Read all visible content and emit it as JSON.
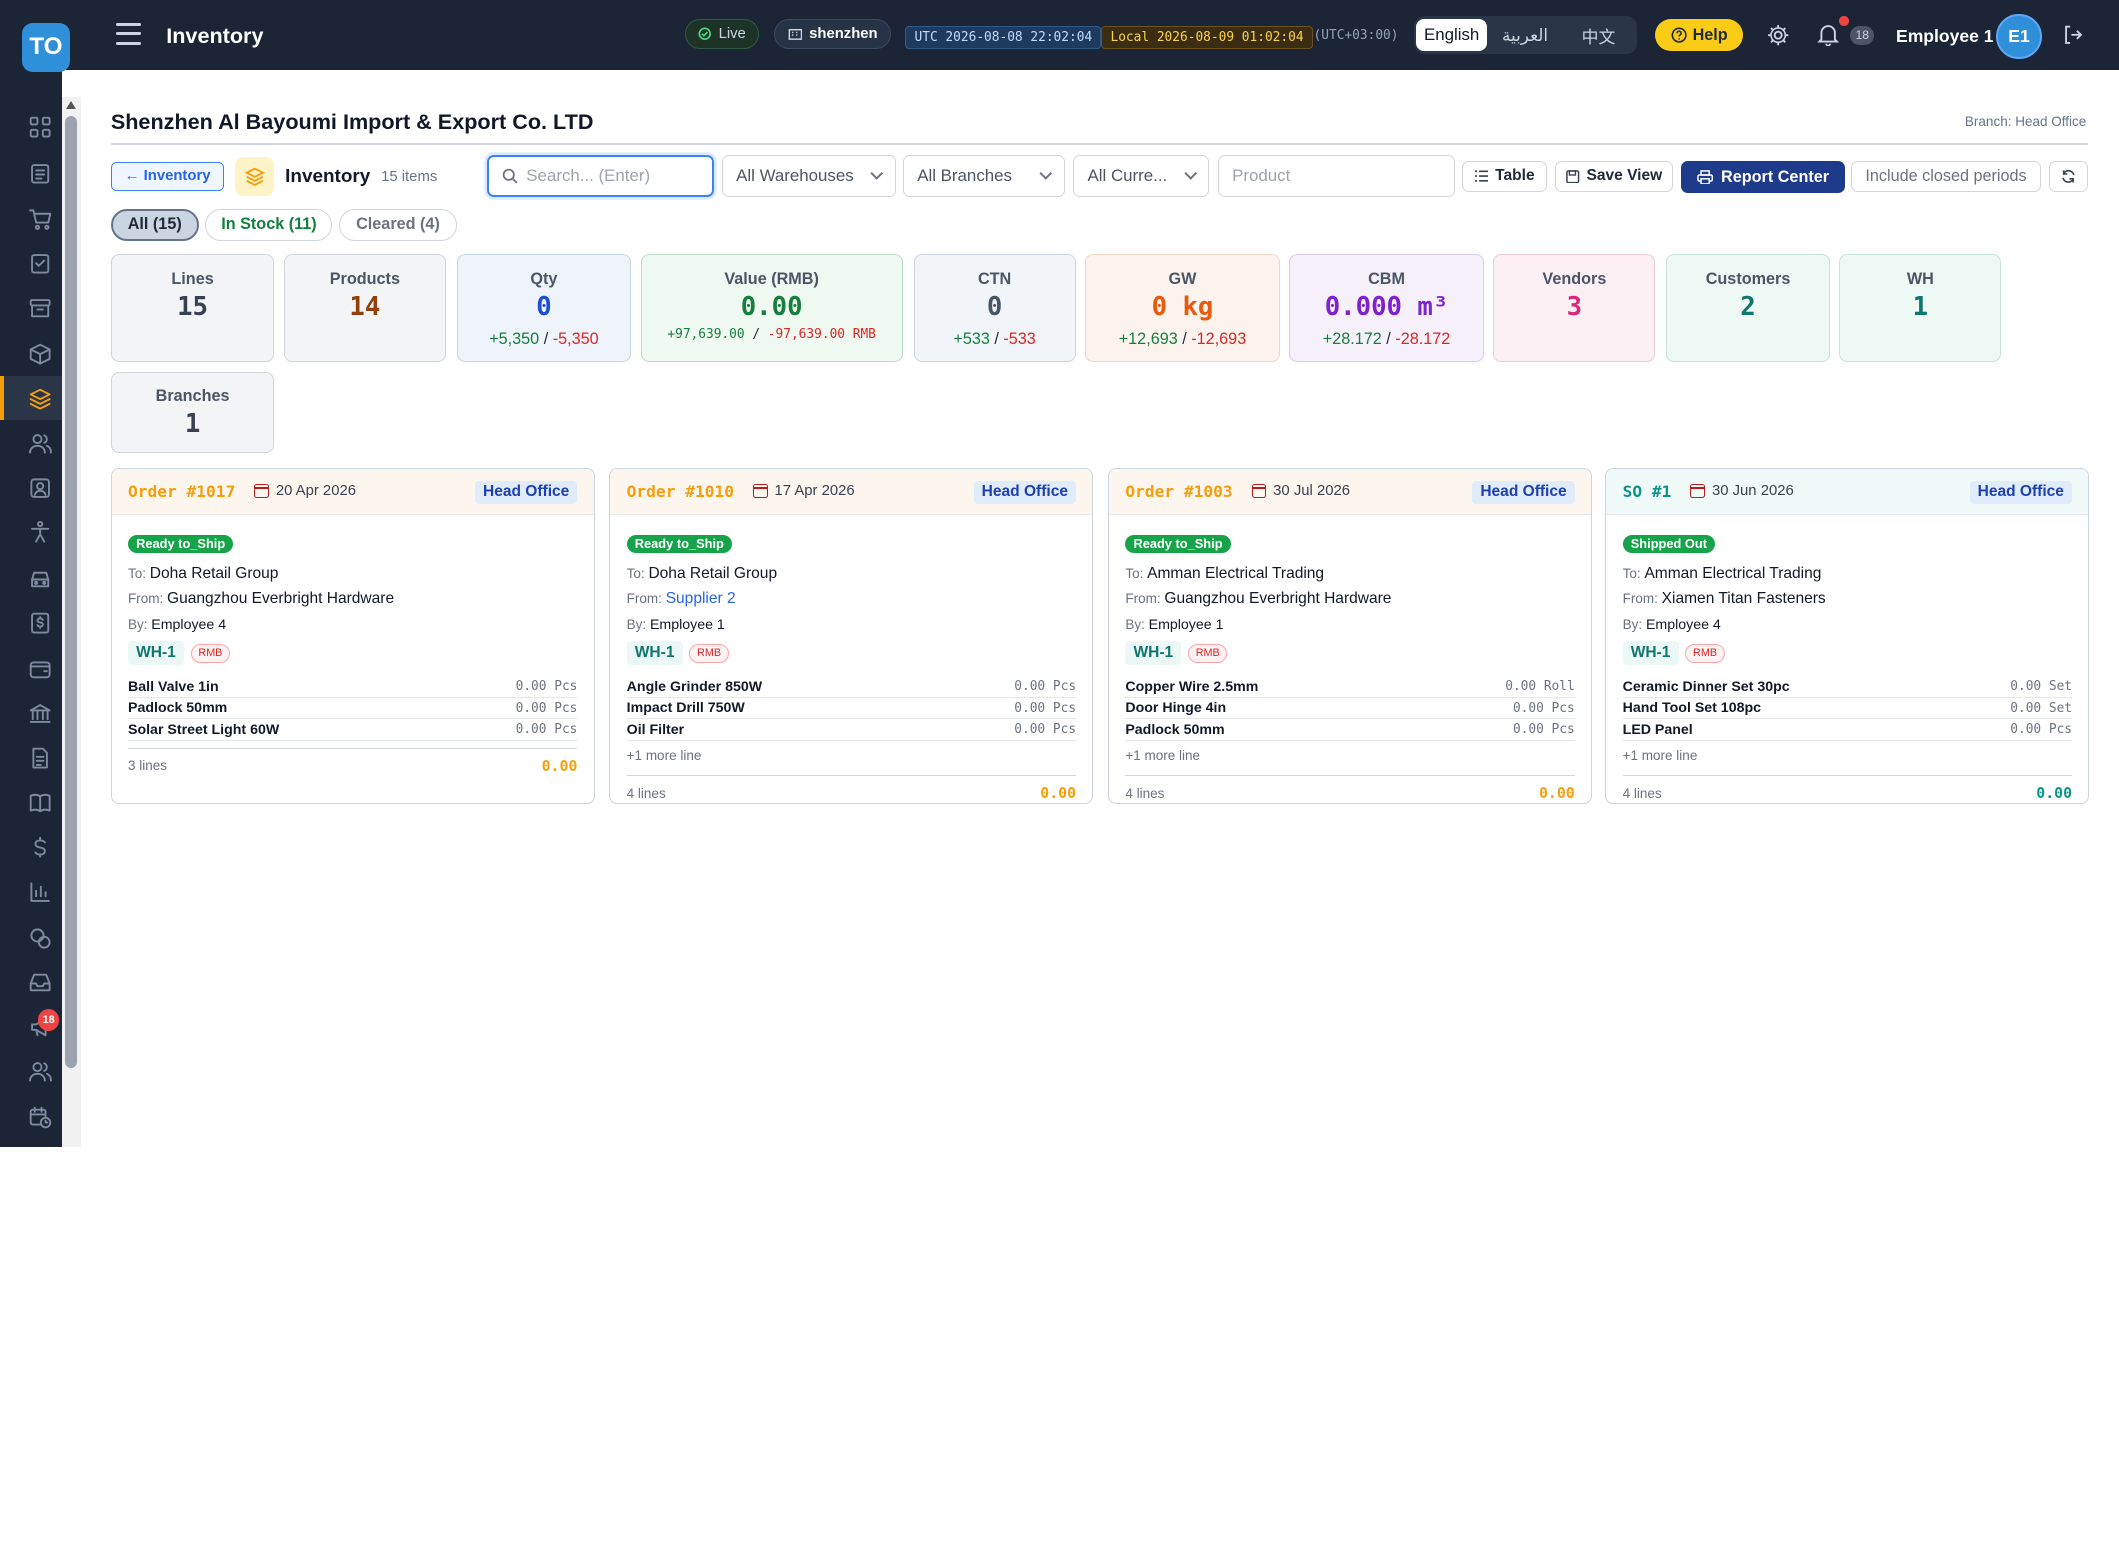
{
  "app": {
    "logo": "TO",
    "title": "Inventory"
  },
  "topbar": {
    "live": "Live",
    "branch": "shenzhen",
    "utc": "UTC 2026-08-08 22:02:04",
    "local": "Local 2026-08-09 01:02:04",
    "offset": "(UTC+03:00)",
    "languages": [
      "English",
      "العربية",
      "中文"
    ],
    "active_language": "English",
    "help": "Help",
    "notifications": "18",
    "user": "Employee 1",
    "avatar": "E1"
  },
  "sidebar": {
    "badge": "18",
    "icons": [
      "dashboard-icon",
      "clipboard-icon",
      "cart-icon",
      "checklist-icon",
      "archive-icon",
      "box-icon",
      "layers-icon",
      "users-icon",
      "contacts-icon",
      "person-icon",
      "car-icon",
      "dollar-doc-icon",
      "wallet-icon",
      "bank-icon",
      "document-icon",
      "book-icon",
      "dollar-icon",
      "bar-chart-icon",
      "coins-icon",
      "inbox-icon",
      "megaphone-icon",
      "team-icon",
      "calendar-clock-icon"
    ]
  },
  "page": {
    "company": "Shenzhen Al Bayoumi Import & Export Co. LTD",
    "branch_label": "Branch: Head Office",
    "back_label": "← Inventory",
    "title": "Inventory",
    "count": "15 items"
  },
  "toolbar": {
    "search_placeholder": "Search... (Enter)",
    "warehouses": "All Warehouses",
    "branches": "All Branches",
    "currencies": "All Curre...",
    "product_placeholder": "Product",
    "table": "Table",
    "save_view": "Save View",
    "report_center": "Report Center",
    "include_closed": "Include closed periods"
  },
  "filters": {
    "all": "All (15)",
    "in_stock": "In Stock (11)",
    "cleared": "Cleared (4)"
  },
  "stats": {
    "lines": {
      "label": "Lines",
      "value": "15"
    },
    "products": {
      "label": "Products",
      "value": "14"
    },
    "qty": {
      "label": "Qty",
      "value": "0",
      "plus": "+5,350",
      "minus": "-5,350"
    },
    "value": {
      "label": "Value (RMB)",
      "value": "0.00",
      "plus": "+97,639.00",
      "minus": "-97,639.00 RMB"
    },
    "ctn": {
      "label": "CTN",
      "value": "0",
      "plus": "+533",
      "minus": "-533"
    },
    "gw": {
      "label": "GW",
      "value": "0 kg",
      "plus": "+12,693",
      "minus": "-12,693"
    },
    "cbm": {
      "label": "CBM",
      "value": "0.000 m³",
      "plus": "+28.172",
      "minus": "-28.172"
    },
    "vendors": {
      "label": "Vendors",
      "value": "3"
    },
    "customers": {
      "label": "Customers",
      "value": "2"
    },
    "wh": {
      "label": "WH",
      "value": "1"
    },
    "branches": {
      "label": "Branches",
      "value": "1"
    }
  },
  "cards": [
    {
      "order": "Order #1017",
      "date": "20 Apr 2026",
      "branch": "Head Office",
      "status": "Ready to_Ship",
      "to_label": "To:",
      "to": "Doha Retail Group",
      "from_label": "From:",
      "from": "Guangzhou Everbright Hardware",
      "by_label": "By:",
      "by": "Employee 4",
      "wh": "WH-1",
      "cur": "RMB",
      "items": [
        {
          "name": "Ball Valve 1in",
          "qty": "0.00 Pcs"
        },
        {
          "name": "Padlock 50mm",
          "qty": "0.00 Pcs"
        },
        {
          "name": "Solar Street Light 60W",
          "qty": "0.00 Pcs"
        }
      ],
      "more": "",
      "lines": "3 lines",
      "total": "0.00"
    },
    {
      "order": "Order #1010",
      "date": "17 Apr 2026",
      "branch": "Head Office",
      "status": "Ready to_Ship",
      "to_label": "To:",
      "to": "Doha Retail Group",
      "from_label": "From:",
      "from": "Supplier 2",
      "by_label": "By:",
      "by": "Employee 1",
      "wh": "WH-1",
      "cur": "RMB",
      "items": [
        {
          "name": "Angle Grinder 850W",
          "qty": "0.00 Pcs"
        },
        {
          "name": "Impact Drill 750W",
          "qty": "0.00 Pcs"
        },
        {
          "name": "Oil Filter",
          "qty": "0.00 Pcs"
        }
      ],
      "more": "+1 more line",
      "lines": "4 lines",
      "total": "0.00"
    },
    {
      "order": "Order #1003",
      "date": "30 Jul 2026",
      "branch": "Head Office",
      "status": "Ready to_Ship",
      "to_label": "To:",
      "to": "Amman Electrical Trading",
      "from_label": "From:",
      "from": "Guangzhou Everbright Hardware",
      "by_label": "By:",
      "by": "Employee 1",
      "wh": "WH-1",
      "cur": "RMB",
      "items": [
        {
          "name": "Copper Wire 2.5mm",
          "qty": "0.00 Roll"
        },
        {
          "name": "Door Hinge 4in",
          "qty": "0.00 Pcs"
        },
        {
          "name": "Padlock 50mm",
          "qty": "0.00 Pcs"
        }
      ],
      "more": "+1 more line",
      "lines": "4 lines",
      "total": "0.00"
    },
    {
      "order": "SO #1",
      "date": "30 Jun 2026",
      "branch": "Head Office",
      "status": "Shipped Out",
      "to_label": "To:",
      "to": "Amman Electrical Trading",
      "from_label": "From:",
      "from": "Xiamen Titan Fasteners",
      "by_label": "By:",
      "by": "Employee 4",
      "wh": "WH-1",
      "cur": "RMB",
      "items": [
        {
          "name": "Ceramic Dinner Set 30pc",
          "qty": "0.00 Set"
        },
        {
          "name": "Hand Tool Set 108pc",
          "qty": "0.00 Set"
        },
        {
          "name": "LED Panel",
          "qty": "0.00 Pcs"
        }
      ],
      "more": "+1 more line",
      "lines": "4 lines",
      "total": "0.00"
    }
  ]
}
